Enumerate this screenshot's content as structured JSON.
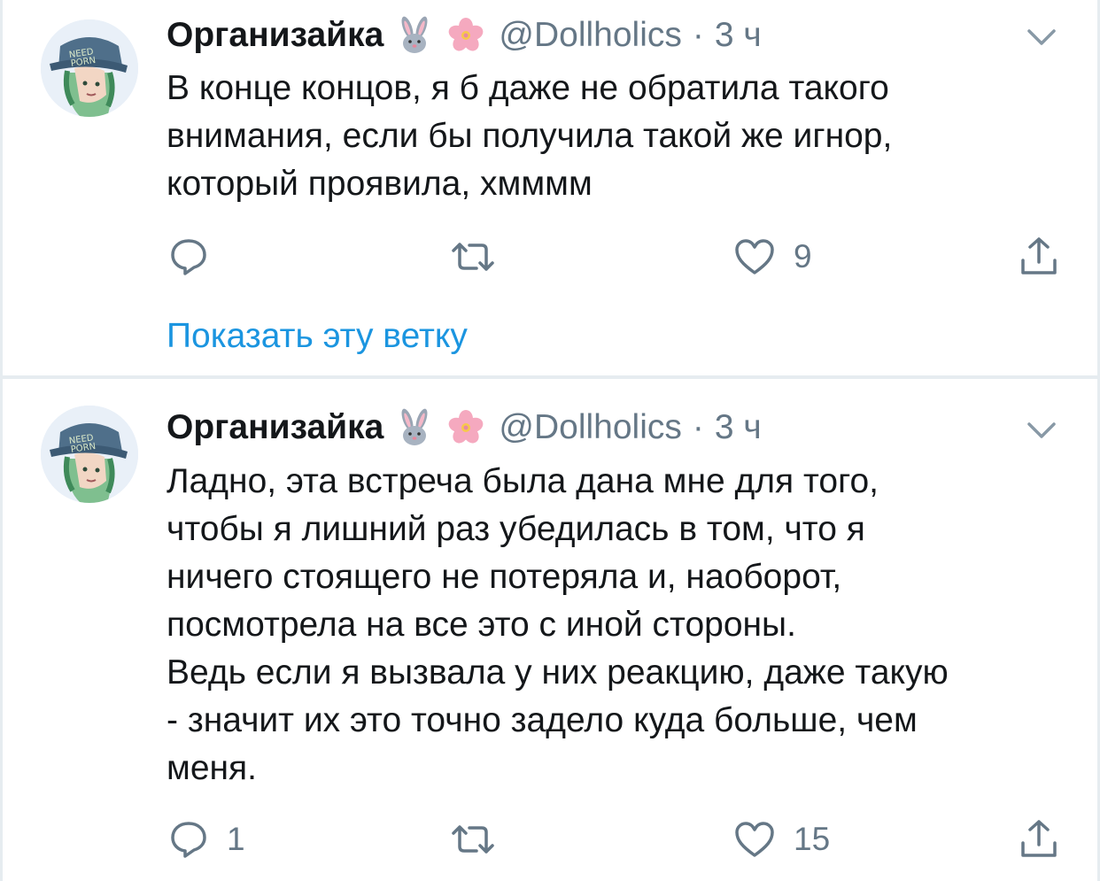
{
  "tweets": [
    {
      "author_name": "Организайка",
      "author_emojis": [
        "rabbit-emoji",
        "cherry-blossom-emoji"
      ],
      "handle": "@Dollholics",
      "separator": "·",
      "time": "3 ч",
      "text": "В конце концов, я б даже не обратила такого\nвнимания, если бы получила такой же игнор,\nкоторый проявила, хмммм",
      "reply_count": "",
      "retweet_count": "",
      "like_count": "9",
      "show_thread": "Показать эту ветку"
    },
    {
      "author_name": "Организайка",
      "author_emojis": [
        "rabbit-emoji",
        "cherry-blossom-emoji"
      ],
      "handle": "@Dollholics",
      "separator": "·",
      "time": "3 ч",
      "text": "Ладно, эта встреча была дана мне для того,\nчтобы я лишний раз убедилась в том, что я\nничего стоящего не потеряла и, наоборот,\nпосмотрела на все это с иной стороны.\nВедь если я вызвала у них реакцию,  даже такую\n- значит их это точно задело куда больше, чем\nменя.",
      "reply_count": "1",
      "retweet_count": "",
      "like_count": "15"
    }
  ],
  "colors": {
    "text_primary": "#14171a",
    "text_secondary": "#657786",
    "link": "#1b95e0",
    "divider": "#e6ecf0"
  }
}
